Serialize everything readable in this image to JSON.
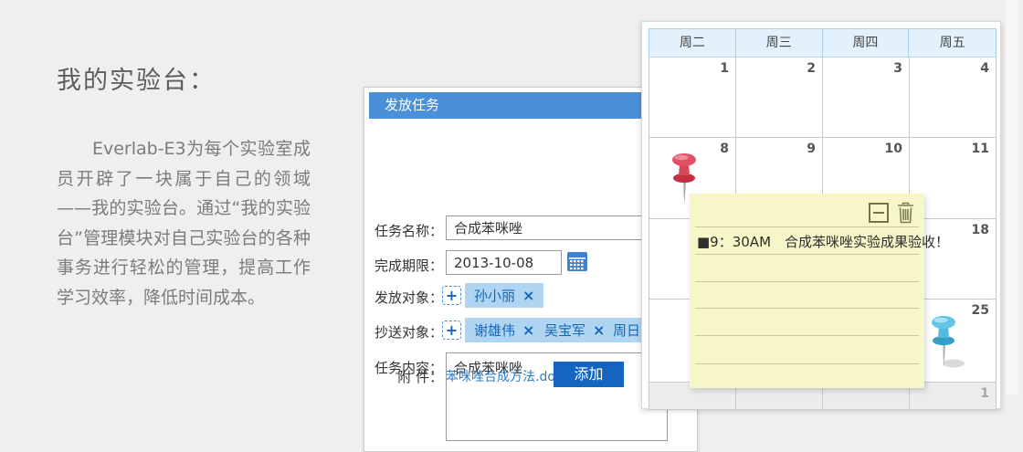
{
  "colors": {
    "page_bg": "#efefef",
    "accent": "#4a90d8",
    "button": "#1565c0",
    "chip_bg": "#b0d5f2",
    "chip_text": "#1467b8",
    "cal_head_bg": "#e2f1fb",
    "note_bg": "#f6f6c8",
    "pin_red": "#e05165",
    "pin_blue": "#63c4e4"
  },
  "intro": {
    "title": "我的实验台：",
    "body": "　　Everlab-E3为每个实验室成员开辟了一块属于自己的领域——我的实验台。通过“我的实验台”管理模块对自己实验台的各种事务进行轻松的管理，提高工作学习效率，降低时间成本。"
  },
  "task_dialog": {
    "title": "发放任务",
    "task_name": {
      "label": "任务名称：",
      "value": "合成苯咪唑"
    },
    "deadline": {
      "label": "完成期限：",
      "value": "2013-10-08"
    },
    "assignees": {
      "label": "发放对象：",
      "chips": [
        {
          "name": "孙小丽"
        }
      ]
    },
    "cc": {
      "label": "抄送对象：",
      "chips": [
        {
          "name": "谢雄伟"
        },
        {
          "name": "吴宝军"
        },
        {
          "name": "周日"
        }
      ]
    },
    "content": {
      "label": "任务内容：",
      "value": "合成苯咪唑"
    },
    "attachment": {
      "label": "附 件：",
      "file_name": "苯咪唑合成方法.docx",
      "add_button": "添加"
    }
  },
  "icons": {
    "add_member_glyph": "+",
    "remove_chip_glyph": "×"
  },
  "calendar": {
    "weekdays": [
      "周二",
      "周三",
      "周四",
      "周五"
    ],
    "rows": [
      {
        "cells": [
          "1",
          "2",
          "3",
          "4"
        ]
      },
      {
        "cells": [
          "8",
          "9",
          "10",
          "11"
        ]
      },
      {
        "cells": [
          "",
          "",
          "",
          "18"
        ]
      },
      {
        "cells": [
          "",
          "",
          "",
          "25"
        ]
      },
      {
        "cells": [
          "",
          "",
          "",
          "1"
        ]
      }
    ]
  },
  "note": {
    "text": "■9：30AM　合成苯咪唑实验成果验收！"
  }
}
